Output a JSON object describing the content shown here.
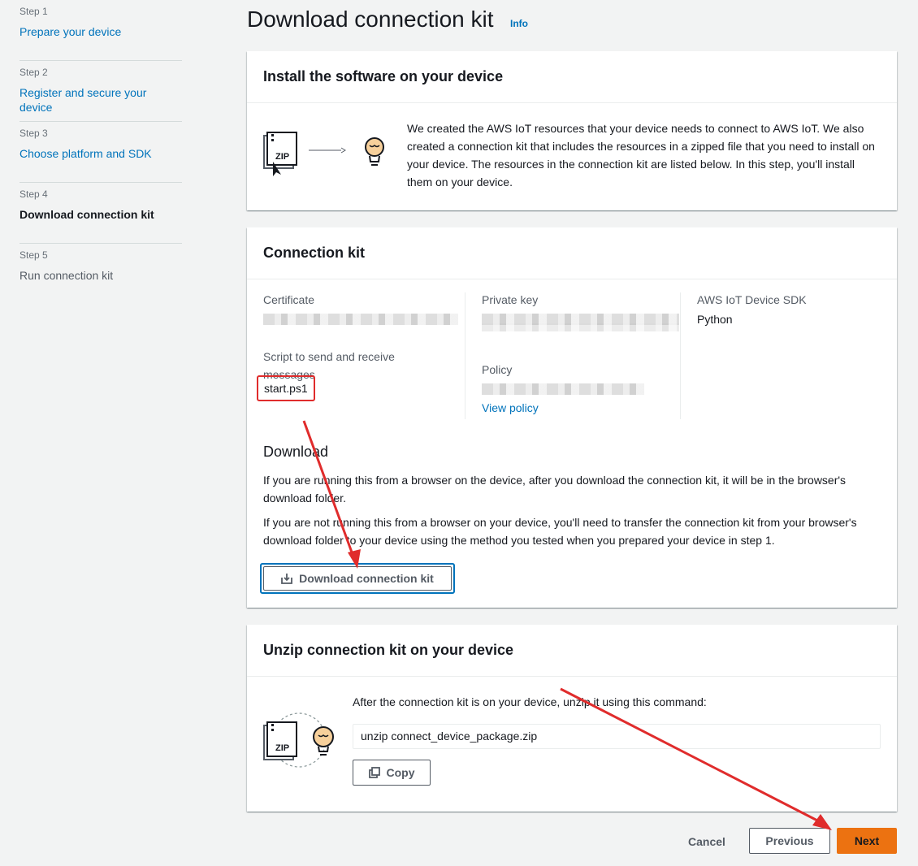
{
  "sidebar": {
    "steps": [
      {
        "num": "Step 1",
        "label": "Prepare your device"
      },
      {
        "num": "Step 2",
        "label": "Register and secure your device"
      },
      {
        "num": "Step 3",
        "label": "Choose platform and SDK"
      },
      {
        "num": "Step 4",
        "label": "Download connection kit"
      },
      {
        "num": "Step 5",
        "label": "Run connection kit"
      }
    ]
  },
  "page": {
    "title": "Download connection kit",
    "info_link": "Info"
  },
  "install_panel": {
    "title": "Install the software on your device",
    "zip_label": "ZIP",
    "description": "We created the AWS IoT resources that your device needs to connect to AWS IoT. We also created a connection kit that includes the resources in a zipped file that you need to install on your device. The resources in the connection kit are listed below. In this step, you'll install them on your device."
  },
  "kit_panel": {
    "title": "Connection kit",
    "certificate_label": "Certificate",
    "script_label": "Script to send and receive messages",
    "script_value": "start.ps1",
    "private_key_label": "Private key",
    "policy_label": "Policy",
    "view_policy": "View policy",
    "sdk_label": "AWS IoT Device SDK",
    "sdk_value": "Python",
    "download_title": "Download",
    "download_p1": "If you are running this from a browser on the device, after you download the connection kit, it will be in the browser's download folder.",
    "download_p2": "If you are not running this from a browser on your device, you'll need to transfer the connection kit from your browser's download folder to your device using the method you tested when you prepared your device in step 1.",
    "download_button": "Download connection kit"
  },
  "unzip_panel": {
    "title": "Unzip connection kit on your device",
    "zip_label": "ZIP",
    "instruction": "After the connection kit is on your device, unzip it using this command:",
    "command": "unzip connect_device_package.zip",
    "copy_button": "Copy"
  },
  "footer": {
    "cancel": "Cancel",
    "previous": "Previous",
    "next": "Next"
  },
  "colors": {
    "link": "#0073bb",
    "primary": "#ec7211",
    "annotation": "#e02c2c",
    "background": "#f2f3f3"
  }
}
